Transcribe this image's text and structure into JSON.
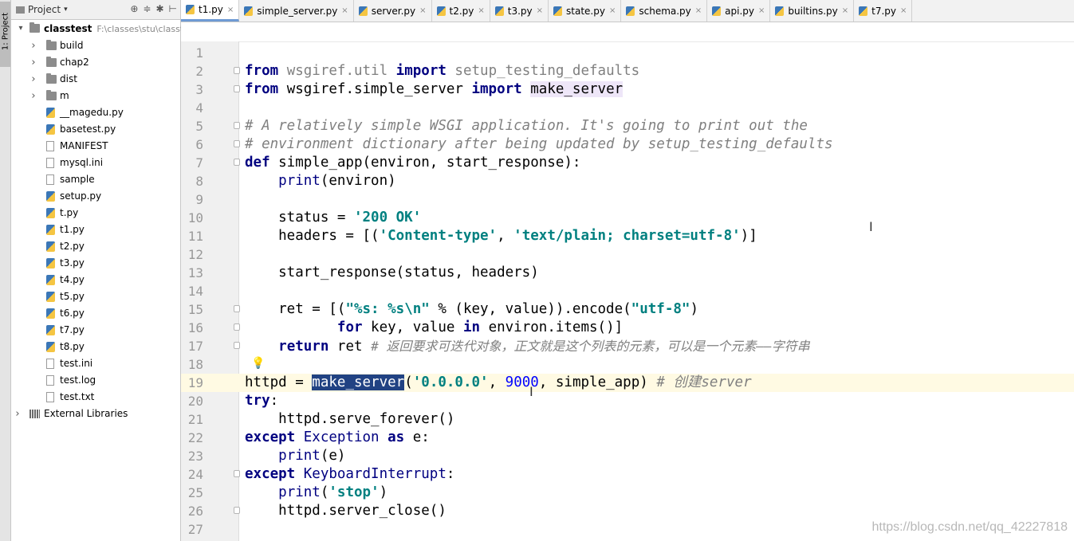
{
  "toolstrip": {
    "project_tab": "1: Project"
  },
  "panel": {
    "title": "Project",
    "root": {
      "name": "classtest",
      "path": "F:\\classes\\stu\\classt"
    },
    "items": [
      {
        "name": "build",
        "type": "folder"
      },
      {
        "name": "chap2",
        "type": "folder"
      },
      {
        "name": "dist",
        "type": "folder"
      },
      {
        "name": "m",
        "type": "folder"
      },
      {
        "name": "__magedu.py",
        "type": "py"
      },
      {
        "name": "basetest.py",
        "type": "py"
      },
      {
        "name": "MANIFEST",
        "type": "txt"
      },
      {
        "name": "mysql.ini",
        "type": "txt"
      },
      {
        "name": "sample",
        "type": "txt"
      },
      {
        "name": "setup.py",
        "type": "py"
      },
      {
        "name": "t.py",
        "type": "py"
      },
      {
        "name": "t1.py",
        "type": "py"
      },
      {
        "name": "t2.py",
        "type": "py"
      },
      {
        "name": "t3.py",
        "type": "py"
      },
      {
        "name": "t4.py",
        "type": "py"
      },
      {
        "name": "t5.py",
        "type": "py"
      },
      {
        "name": "t6.py",
        "type": "py"
      },
      {
        "name": "t7.py",
        "type": "py"
      },
      {
        "name": "t8.py",
        "type": "py"
      },
      {
        "name": "test.ini",
        "type": "txt"
      },
      {
        "name": "test.log",
        "type": "txt"
      },
      {
        "name": "test.txt",
        "type": "txt"
      }
    ],
    "external": "External Libraries"
  },
  "tabs": [
    {
      "label": "t1.py",
      "active": true
    },
    {
      "label": "simple_server.py"
    },
    {
      "label": "server.py"
    },
    {
      "label": "t2.py"
    },
    {
      "label": "t3.py"
    },
    {
      "label": "state.py"
    },
    {
      "label": "schema.py"
    },
    {
      "label": "api.py"
    },
    {
      "label": "builtins.py"
    },
    {
      "label": "t7.py"
    }
  ],
  "code": {
    "l2": {
      "kw1": "from",
      "mod": " wsgiref.util ",
      "kw2": "import",
      "name": " setup_testing_defaults"
    },
    "l3": {
      "kw1": "from",
      "mod": " wsgiref.simple_server ",
      "kw2": "import",
      "sp": " ",
      "name": "make_server"
    },
    "l5": "# A relatively simple WSGI application. It's going to print out the",
    "l6": "# environment dictionary after being updated by setup_testing_defaults",
    "l7": {
      "kw": "def",
      "rest": " simple_app(environ, start_response):"
    },
    "l8": {
      "indent": "    ",
      "fn": "print",
      "rest": "(environ)"
    },
    "l10": {
      "a": "    status = ",
      "s": "'200 OK'"
    },
    "l11": {
      "a": "    headers = [(",
      "s1": "'Content-type'",
      "b": ", ",
      "s2": "'text/plain; charset=utf-8'",
      "c": ")]"
    },
    "l13": "    start_response(status, headers)",
    "l15": {
      "a": "    ret = [(",
      "s": "\"%s: %s\\n\"",
      "b": " % (key, value)).encode(",
      "s2": "\"utf-8\"",
      "c": ")"
    },
    "l16": {
      "a": "           ",
      "kw1": "for",
      "b": " key, value ",
      "kw2": "in",
      "c": " environ.items()]"
    },
    "l17": {
      "a": "    ",
      "kw": "return",
      "b": " ret ",
      "cm": "# 返回要求可迭代对象，正文就是这个列表的元素，可以是一个元素——字符串"
    },
    "l19": {
      "a": "httpd = ",
      "sel": "make_server",
      "b": "(",
      "s": "'0.0.0.0'",
      "c": ", ",
      "n": "9000",
      "d": ", simple_app) ",
      "cm": "# 创建server"
    },
    "l20": {
      "kw": "try",
      "rest": ":"
    },
    "l21": "    httpd.serve_forever()",
    "l22": {
      "kw1": "except",
      "cls": " Exception ",
      "kw2": "as",
      "rest": " e:"
    },
    "l23": {
      "indent": "    ",
      "fn": "print",
      "rest": "(e)"
    },
    "l24": {
      "kw": "except",
      "cls": " KeyboardInterrupt",
      "rest": ":"
    },
    "l25": {
      "indent": "    ",
      "fn": "print",
      "b": "(",
      "s": "'stop'",
      "c": ")"
    },
    "l26": "    httpd.server_close()"
  },
  "line_numbers": [
    "1",
    "2",
    "3",
    "4",
    "5",
    "6",
    "7",
    "8",
    "9",
    "10",
    "11",
    "12",
    "13",
    "14",
    "15",
    "16",
    "17",
    "18",
    "19",
    "20",
    "21",
    "22",
    "23",
    "24",
    "25",
    "26",
    "27"
  ],
  "watermark": "https://blog.csdn.net/qq_42227818"
}
